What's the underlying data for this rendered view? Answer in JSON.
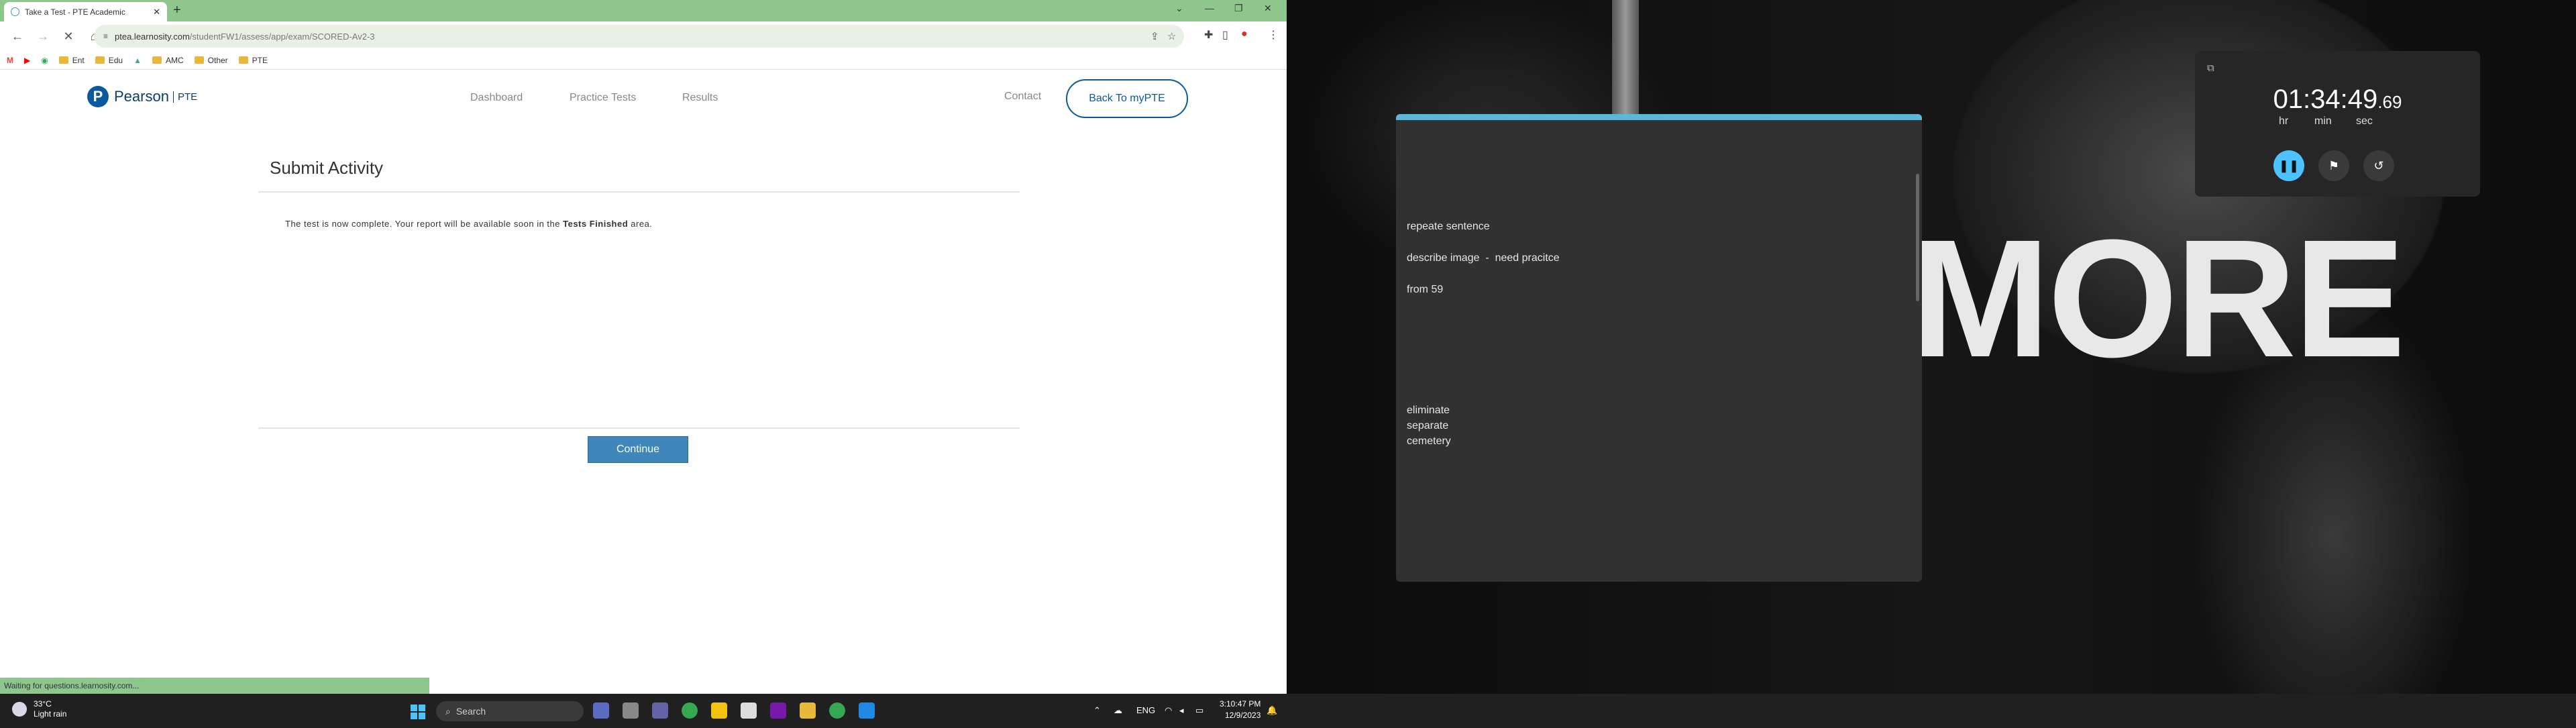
{
  "browser": {
    "tab_title": "Take a Test - PTE Academic",
    "url_host": "ptea.learnosity.com",
    "url_path": "/studentFW1/assess/app/exam/SCORED-Av2-3",
    "bookmarks": [
      "Ent",
      "Edu",
      "AMC",
      "Other",
      "PTE"
    ],
    "status_text": "Waiting for questions.learnosity.com..."
  },
  "site": {
    "brand": "Pearson",
    "brand_suffix": "PTE",
    "nav": [
      "Dashboard",
      "Practice Tests",
      "Results"
    ],
    "contact": "Contact",
    "back_button": "Back To myPTE"
  },
  "activity": {
    "heading": "Submit Activity",
    "message_pre": "The test is now complete. Your report will be available soon in the ",
    "message_bold": "Tests Finished",
    "message_post": " area.",
    "continue_label": "Continue"
  },
  "notes": {
    "lines": [
      "repeate sentence",
      "describe image  -  need pracitce",
      "from 59",
      "eliminate",
      "separate",
      "cemetery"
    ]
  },
  "wallpaper": {
    "text": "MORE"
  },
  "timer": {
    "main": "01:34:49",
    "fraction": ".69",
    "labels": [
      "hr",
      "min",
      "sec"
    ],
    "accent": "#4cc2ff"
  },
  "taskbar": {
    "temperature": "33°C",
    "weather": "Light rain",
    "search_placeholder": "Search",
    "language": "ENG",
    "time": "3:10:47 PM",
    "date": "12/9/2023"
  }
}
